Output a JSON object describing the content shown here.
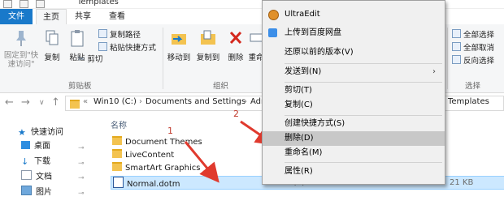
{
  "window": {
    "title": "Templates"
  },
  "ribbon_tabs": [
    "文件",
    "主页",
    "共享",
    "查看"
  ],
  "ribbon": {
    "pin_label": "固定到\"快速访问\"",
    "copy_label": "复制",
    "paste_label": "粘贴",
    "copy_path_label": "复制路径",
    "paste_shortcut_label": "粘贴快捷方式",
    "cut_label": "剪切",
    "clipboard_group": "剪贴板",
    "move_to_label": "移动到",
    "copy_to_label": "复制到",
    "delete_label": "删除",
    "rename_label": "重命",
    "organize_group": "组织",
    "select_all_label": "全部选择",
    "select_none_label": "全部取消",
    "invert_label": "反向选择",
    "select_group": "选择"
  },
  "address": {
    "crumbs": [
      "Win10 (C:)",
      "Documents and Settings",
      "Adr"
    ],
    "tail": "Templates"
  },
  "nav": {
    "items": [
      {
        "label": "快速访问"
      },
      {
        "label": "桌面"
      },
      {
        "label": "下载"
      },
      {
        "label": "文档"
      },
      {
        "label": "图片"
      }
    ]
  },
  "files": {
    "name_header": "名称",
    "rows": [
      {
        "name": "Document Themes",
        "date": "",
        "type": "",
        "size": ""
      },
      {
        "name": "LiveContent",
        "date": "",
        "type": "",
        "size": ""
      },
      {
        "name": "SmartArt Graphics",
        "date": "",
        "type": "",
        "size": ""
      },
      {
        "name": "Normal.dotm",
        "date": "2018/5/31 16:24",
        "type": "Microsoft Word ...",
        "size": "21 KB"
      }
    ]
  },
  "context_menu": {
    "items": [
      {
        "label": "UltraEdit"
      },
      {
        "label": "上传到百度网盘"
      },
      {
        "label": "还原以前的版本(V)"
      },
      {
        "label": "发送到(N)",
        "submenu": true
      },
      {
        "label": "剪切(T)"
      },
      {
        "label": "复制(C)"
      },
      {
        "label": "创建快捷方式(S)"
      },
      {
        "label": "删除(D)",
        "highlighted": true
      },
      {
        "label": "重命名(M)"
      },
      {
        "label": "属性(R)"
      }
    ]
  },
  "annotations": {
    "one": "1",
    "two": "2"
  },
  "colors": {
    "accent": "#1979ca",
    "selection": "#cce8ff",
    "arrow": "#e03a2e"
  }
}
